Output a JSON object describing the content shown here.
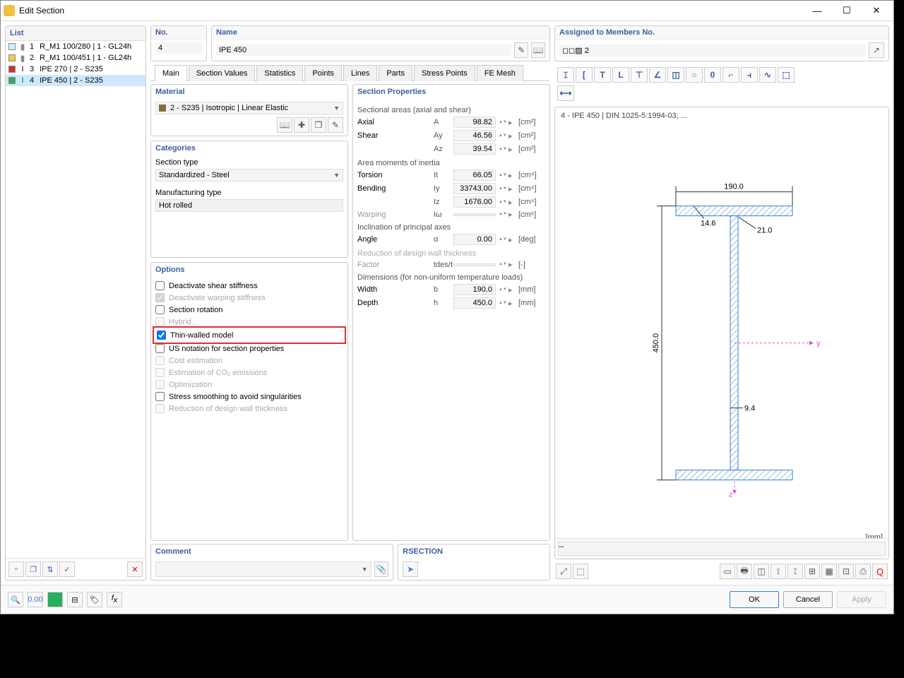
{
  "window": {
    "title": "Edit Section"
  },
  "winbtns": {
    "min": "—",
    "max": "☐",
    "close": "✕"
  },
  "left": {
    "header": "List",
    "items": [
      {
        "num": "1",
        "label": "R_M1 100/280 | 1 - GL24h",
        "swatch": "#c8f4f4",
        "shapeColor": "#888"
      },
      {
        "num": "2",
        "label": "R_M1 100/451 | 1 - GL24h",
        "swatch": "#f7c948",
        "shapeColor": "#888"
      },
      {
        "num": "3",
        "label": "IPE 270 | 2 - S235",
        "swatch": "#c0392b",
        "shapeColor": "#c0392b",
        "ibeam": true
      },
      {
        "num": "4",
        "label": "IPE 450 | 2 - S235",
        "swatch": "#27ae60",
        "shapeColor": "#27ae60",
        "ibeam": true,
        "selected": true
      }
    ],
    "del_icon": "✕"
  },
  "top": {
    "no_label": "No.",
    "no_value": "4",
    "name_label": "Name",
    "name_value": "IPE 450",
    "assigned_label": "Assigned to Members No.",
    "assigned_value": "◻◻▨ 2"
  },
  "tabs": [
    "Main",
    "Section Values",
    "Statistics",
    "Points",
    "Lines",
    "Parts",
    "Stress Points",
    "FE Mesh"
  ],
  "material": {
    "head": "Material",
    "value": "2 - S235 | Isotropic | Linear Elastic"
  },
  "categories": {
    "head": "Categories",
    "section_type_label": "Section type",
    "section_type_value": "Standardized - Steel",
    "manu_label": "Manufacturing type",
    "manu_value": "Hot rolled"
  },
  "options": {
    "head": "Options",
    "items": [
      {
        "label": "Deactivate shear stiffness",
        "checked": false,
        "disabled": false
      },
      {
        "label": "Deactivate warping stiffness",
        "checked": true,
        "disabled": true
      },
      {
        "label": "Section rotation",
        "checked": false,
        "disabled": false
      },
      {
        "label": "Hybrid...",
        "checked": false,
        "disabled": true
      },
      {
        "label": "Thin-walled model",
        "checked": true,
        "disabled": false,
        "highlighted": true
      },
      {
        "label": "US notation for section properties",
        "checked": false,
        "disabled": false
      },
      {
        "label": "Cost estimation",
        "checked": false,
        "disabled": true
      },
      {
        "label": "Estimation of CO₂ emissions",
        "checked": false,
        "disabled": true
      },
      {
        "label": "Optimization",
        "checked": false,
        "disabled": true
      },
      {
        "label": "Stress smoothing to avoid singularities",
        "checked": false,
        "disabled": false
      },
      {
        "label": "Reduction of design wall thickness",
        "checked": false,
        "disabled": true
      }
    ]
  },
  "props": {
    "head": "Section Properties",
    "groups": [
      {
        "sub": "Sectional areas (axial and shear)",
        "rows": [
          {
            "label": "Axial",
            "sym": "A",
            "val": "98.82",
            "unit": "[cm²]"
          },
          {
            "label": "Shear",
            "sym": "Ay",
            "val": "46.56",
            "unit": "[cm²]"
          },
          {
            "label": "",
            "sym": "Az",
            "val": "39.54",
            "unit": "[cm²]"
          }
        ]
      },
      {
        "sub": "Area moments of inertia",
        "rows": [
          {
            "label": "Torsion",
            "sym": "It",
            "val": "66.05",
            "unit": "[cm⁴]"
          },
          {
            "label": "Bending",
            "sym": "Iy",
            "val": "33743.00",
            "unit": "[cm⁴]"
          },
          {
            "label": "",
            "sym": "Iz",
            "val": "1676.00",
            "unit": "[cm⁴]"
          },
          {
            "label": "Warping",
            "sym": "Iω",
            "val": "",
            "unit": "[cm⁶]",
            "disabled": true
          }
        ]
      },
      {
        "sub": "Inclination of principal axes",
        "rows": [
          {
            "label": "Angle",
            "sym": "α",
            "val": "0.00",
            "unit": "[deg]"
          }
        ]
      },
      {
        "sub": "Reduction of design wall thickness",
        "disabled": true,
        "rows": [
          {
            "label": "Factor",
            "sym": "tdes/t",
            "val": "",
            "unit": "[-]",
            "disabled": true
          }
        ]
      },
      {
        "sub": "Dimensions (for non-uniform temperature loads)",
        "rows": [
          {
            "label": "Width",
            "sym": "b",
            "val": "190.0",
            "unit": "[mm]"
          },
          {
            "label": "Depth",
            "sym": "h",
            "val": "450.0",
            "unit": "[mm]"
          }
        ]
      }
    ]
  },
  "comment": {
    "head": "Comment"
  },
  "rsection": {
    "head": "RSECTION"
  },
  "preview": {
    "caption": "4 - IPE 450 | DIN 1025-5:1994-03; ...",
    "unit": "[mm]",
    "dims": {
      "width": "190.0",
      "height": "450.0",
      "tf": "14.6",
      "tw": "9.4",
      "r": "21.0"
    },
    "shape_icons": [
      "𝙸",
      "[",
      "T",
      "L",
      "⊤",
      "∠",
      "◫",
      "○",
      "0",
      "⌐",
      "⫞",
      "∿",
      "⬚"
    ]
  },
  "footer": {
    "ok": "OK",
    "cancel": "Cancel",
    "apply": "Apply"
  }
}
